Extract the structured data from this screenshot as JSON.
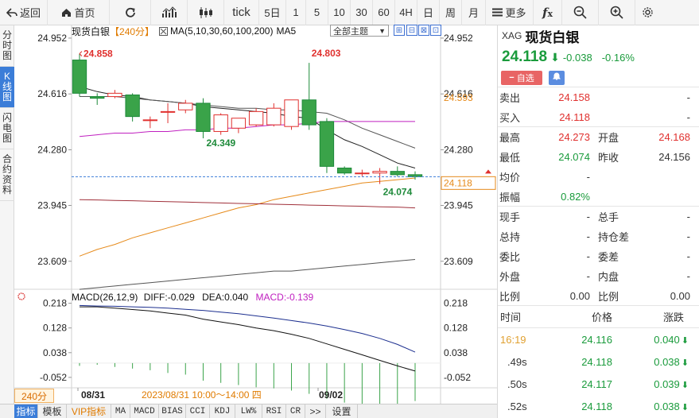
{
  "toolbar": {
    "back": "返回",
    "home": "首页",
    "tick": "tick",
    "day5": "5日",
    "p1": "1",
    "p5": "5",
    "p10": "10",
    "p30": "30",
    "p60": "60",
    "p4h": "4H",
    "day": "日",
    "week": "周",
    "month": "月",
    "more": "更多"
  },
  "leftnav": [
    {
      "label": [
        "分",
        "时",
        "图"
      ],
      "active": false
    },
    {
      "label": [
        "K",
        "线",
        "图"
      ],
      "active": true
    },
    {
      "label": [
        "闪",
        "电",
        "图"
      ],
      "active": false
    },
    {
      "label": [
        "合",
        "约",
        "资",
        "料"
      ],
      "active": false
    }
  ],
  "legend": {
    "name": "现货白银",
    "period": "【240分】",
    "ma": "MA(5,10,30,60,100,200)",
    "ma5": "MA5"
  },
  "theme": {
    "label": "全部主题",
    "arrow": "▼"
  },
  "macd": {
    "title": "MACD(26,12,9)",
    "diff": "DIFF:-0.029",
    "dea": "DEA:0.040",
    "macd": "MACD:-0.139"
  },
  "axis": {
    "price_ticks": [
      "24.952",
      "24.616",
      "24.280",
      "23.945",
      "23.609"
    ],
    "macd_ticks": [
      "0.218",
      "0.128",
      "0.038",
      "-0.052"
    ],
    "ma_tag": "24.593",
    "current_tag": "24.118",
    "x_labels": [
      "08/31",
      "2023/08/31 10:00～14:00 四",
      "09/02"
    ]
  },
  "annotations": {
    "high1": "24.858",
    "high2": "24.803",
    "low1": "24.349",
    "low2": "24.074"
  },
  "periodLabel": "240分",
  "bottombar": [
    "指标",
    "模板",
    "VIP指标",
    "MA",
    "MACD",
    "BIAS",
    "CCI",
    "KDJ",
    "LW%",
    "RSI",
    "CR",
    ">>",
    "设置"
  ],
  "chart_data": {
    "type": "candlestick",
    "candles": [
      {
        "o": 24.82,
        "h": 24.858,
        "l": 24.6,
        "c": 24.62
      },
      {
        "o": 24.6,
        "h": 24.62,
        "l": 24.55,
        "c": 24.59
      },
      {
        "o": 24.6,
        "h": 24.64,
        "l": 24.59,
        "c": 24.62
      },
      {
        "o": 24.61,
        "h": 24.62,
        "l": 24.45,
        "c": 24.48
      },
      {
        "o": 24.46,
        "h": 24.48,
        "l": 24.41,
        "c": 24.46
      },
      {
        "o": 24.51,
        "h": 24.56,
        "l": 24.44,
        "c": 24.51
      },
      {
        "o": 24.52,
        "h": 24.58,
        "l": 24.5,
        "c": 24.56
      },
      {
        "o": 24.56,
        "h": 24.59,
        "l": 24.349,
        "c": 24.39
      },
      {
        "o": 24.39,
        "h": 24.5,
        "l": 24.37,
        "c": 24.49
      },
      {
        "o": 24.41,
        "h": 24.47,
        "l": 24.38,
        "c": 24.47
      },
      {
        "o": 24.43,
        "h": 24.53,
        "l": 24.42,
        "c": 24.51
      },
      {
        "o": 24.43,
        "h": 24.56,
        "l": 24.42,
        "c": 24.53
      },
      {
        "o": 24.42,
        "h": 24.58,
        "l": 24.4,
        "c": 24.58
      },
      {
        "o": 24.58,
        "h": 24.803,
        "l": 24.4,
        "c": 24.43
      },
      {
        "o": 24.45,
        "h": 24.47,
        "l": 24.14,
        "c": 24.18
      },
      {
        "o": 24.17,
        "h": 24.18,
        "l": 24.13,
        "c": 24.14
      },
      {
        "o": 24.14,
        "h": 24.16,
        "l": 24.12,
        "c": 24.14
      },
      {
        "o": 24.14,
        "h": 24.17,
        "l": 24.074,
        "c": 24.15
      },
      {
        "o": 24.15,
        "h": 24.18,
        "l": 24.12,
        "c": 24.13
      },
      {
        "o": 24.13,
        "h": 24.15,
        "l": 24.1,
        "c": 24.118
      }
    ],
    "ma_lines": [
      {
        "color": "#222222",
        "values": [
          24.66,
          24.63,
          24.61,
          24.6,
          24.58,
          24.57,
          24.56,
          24.54,
          24.53,
          24.52,
          24.51,
          24.5,
          24.48,
          24.47,
          24.4,
          24.34,
          24.3,
          24.25,
          24.2,
          24.17
        ]
      },
      {
        "color": "#555555",
        "values": [
          24.6,
          24.6,
          24.6,
          24.59,
          24.58,
          24.57,
          24.56,
          24.55,
          24.54,
          24.53,
          24.53,
          24.52,
          24.52,
          24.51,
          24.5,
          24.46,
          24.41,
          24.37,
          24.33,
          24.29
        ]
      },
      {
        "color": "#c020c0",
        "values": [
          24.36,
          24.37,
          24.38,
          24.38,
          24.39,
          24.39,
          24.4,
          24.4,
          24.41,
          24.41,
          24.42,
          24.43,
          24.43,
          24.44,
          24.45,
          24.45,
          24.45,
          24.45,
          24.45,
          24.45
        ]
      },
      {
        "color": "#e68a1a",
        "values": [
          23.64,
          23.68,
          23.71,
          23.75,
          23.78,
          23.81,
          23.84,
          23.87,
          23.9,
          23.93,
          23.95,
          23.98,
          24.0,
          24.02,
          24.04,
          24.06,
          24.08,
          24.09,
          24.1,
          24.11
        ]
      },
      {
        "color": "#a0303a",
        "values": [
          23.98,
          23.978,
          23.975,
          23.973,
          23.97,
          23.968,
          23.965,
          23.962,
          23.96,
          23.957,
          23.955,
          23.952,
          23.95,
          23.947,
          23.945,
          23.942,
          23.94,
          23.937,
          23.935,
          23.93
        ]
      },
      {
        "color": "#555555",
        "values": [
          23.44,
          23.45,
          23.46,
          23.47,
          23.48,
          23.49,
          23.5,
          23.51,
          23.52,
          23.53,
          23.54,
          23.55,
          23.55,
          23.56,
          23.57,
          23.58,
          23.59,
          23.6,
          23.61,
          23.62
        ]
      }
    ],
    "macd": {
      "diff": [
        0.205,
        0.205,
        0.2,
        0.195,
        0.19,
        0.182,
        0.175,
        0.16,
        0.15,
        0.14,
        0.128,
        0.118,
        0.105,
        0.09,
        0.07,
        0.05,
        0.03,
        0.01,
        -0.01,
        -0.029
      ],
      "dea": [
        0.21,
        0.208,
        0.207,
        0.205,
        0.203,
        0.2,
        0.196,
        0.192,
        0.186,
        0.18,
        0.172,
        0.164,
        0.155,
        0.146,
        0.135,
        0.122,
        0.108,
        0.09,
        0.068,
        0.04
      ],
      "ylim": [
        -0.09,
        0.24
      ]
    },
    "ylim": [
      23.45,
      24.99
    ]
  },
  "quote": {
    "symbol": "XAG",
    "name": "现货白银",
    "price": "24.118",
    "arrow": "⬇",
    "change": "-0.038",
    "pct": "-0.16%",
    "self_btn": "自选",
    "rows": [
      [
        {
          "l": "卖出",
          "v": "24.158",
          "c": "red"
        },
        {
          "l": "",
          "v": "-",
          "c": "blk"
        }
      ],
      [
        {
          "l": "买入",
          "v": "24.118",
          "c": "red"
        },
        {
          "l": "",
          "v": "-",
          "c": "blk"
        }
      ],
      [
        {
          "l": "最高",
          "v": "24.273",
          "c": "red"
        },
        {
          "l": "开盘",
          "v": "24.168",
          "c": "red"
        }
      ],
      [
        {
          "l": "最低",
          "v": "24.074",
          "c": "green"
        },
        {
          "l": "昨收",
          "v": "24.156",
          "c": "blk"
        }
      ],
      [
        {
          "l": "均价",
          "v": "-",
          "c": "blk"
        },
        {
          "l": "",
          "v": "",
          "c": "blk"
        }
      ],
      [
        {
          "l": "振幅",
          "v": "0.82%",
          "c": "green"
        },
        {
          "l": "",
          "v": "",
          "c": "blk"
        }
      ],
      [
        {
          "l": "现手",
          "v": "-",
          "c": "blk"
        },
        {
          "l": "总手",
          "v": "-",
          "c": "blk"
        }
      ],
      [
        {
          "l": "总持",
          "v": "-",
          "c": "blk"
        },
        {
          "l": "持仓差",
          "v": "-",
          "c": "blk"
        }
      ],
      [
        {
          "l": "委比",
          "v": "-",
          "c": "blk"
        },
        {
          "l": "委差",
          "v": "-",
          "c": "blk"
        }
      ],
      [
        {
          "l": "外盘",
          "v": "-",
          "c": "blk"
        },
        {
          "l": "内盘",
          "v": "-",
          "c": "blk"
        }
      ],
      [
        {
          "l": "比例",
          "v": "0.00",
          "c": "blk"
        },
        {
          "l": "比例",
          "v": "0.00",
          "c": "blk"
        }
      ]
    ],
    "ticks_header": [
      "时间",
      "价格",
      "涨跌"
    ],
    "ticks": [
      {
        "t": "16:19",
        "p": "24.116",
        "d": "0.040",
        "hl": true
      },
      {
        "t": ".49s",
        "p": "24.118",
        "d": "0.038",
        "hl": false
      },
      {
        "t": ".50s",
        "p": "24.117",
        "d": "0.039",
        "hl": false
      },
      {
        "t": ".52s",
        "p": "24.118",
        "d": "0.038",
        "hl": false
      }
    ]
  }
}
